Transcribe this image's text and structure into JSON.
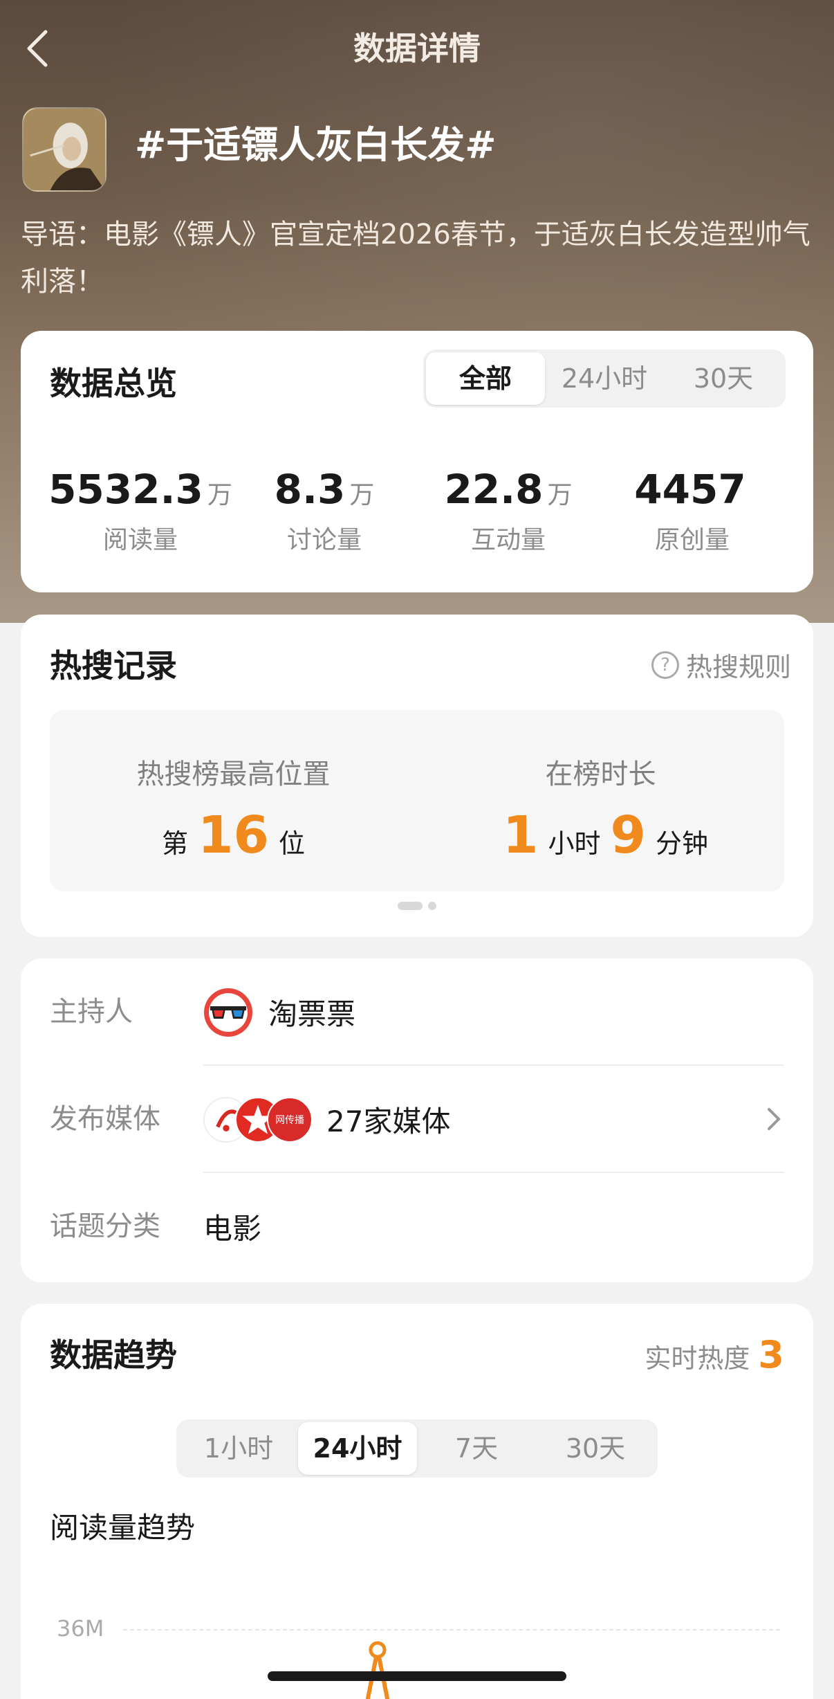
{
  "nav": {
    "title": "数据详情"
  },
  "topic": {
    "title": "#于适镖人灰白长发#",
    "intro": "导语：电影《镖人》官宣定档2026春节，于适灰白长发造型帅气利落！"
  },
  "overview": {
    "title": "数据总览",
    "tabs": [
      "全部",
      "24小时",
      "30天"
    ],
    "active_tab": "全部",
    "stats": [
      {
        "value": "5532.3",
        "unit": "万",
        "label": "阅读量"
      },
      {
        "value": "8.3",
        "unit": "万",
        "label": "讨论量"
      },
      {
        "value": "22.8",
        "unit": "万",
        "label": "互动量"
      },
      {
        "value": "4457",
        "unit": "",
        "label": "原创量"
      }
    ]
  },
  "hot": {
    "title": "热搜记录",
    "rules_label": "热搜规则",
    "rules_icon": "question-circle-icon",
    "highest": {
      "label": "热搜榜最高位置",
      "prefix": "第",
      "value": "16",
      "suffix": "位"
    },
    "duration": {
      "label": "在榜时长",
      "hours": "1",
      "hours_unit": "小时",
      "minutes": "9",
      "minutes_unit": "分钟"
    }
  },
  "info": {
    "host": {
      "label": "主持人",
      "name": "淘票票",
      "icon": "taopiaopiao-logo"
    },
    "media": {
      "label": "发布媒体",
      "value": "27家媒体",
      "logo3_text": "网传播"
    },
    "category": {
      "label": "话题分类",
      "value": "电影"
    }
  },
  "trend": {
    "title": "数据趋势",
    "heat_label": "实时热度",
    "heat_value": "3",
    "tabs": [
      "1小时",
      "24小时",
      "7天",
      "30天"
    ],
    "active_tab": "24小时",
    "chart_label": "阅读量趋势",
    "y_tick": "36M"
  },
  "colors": {
    "accent": "#f08a1d",
    "hero": "#6d5a49"
  }
}
